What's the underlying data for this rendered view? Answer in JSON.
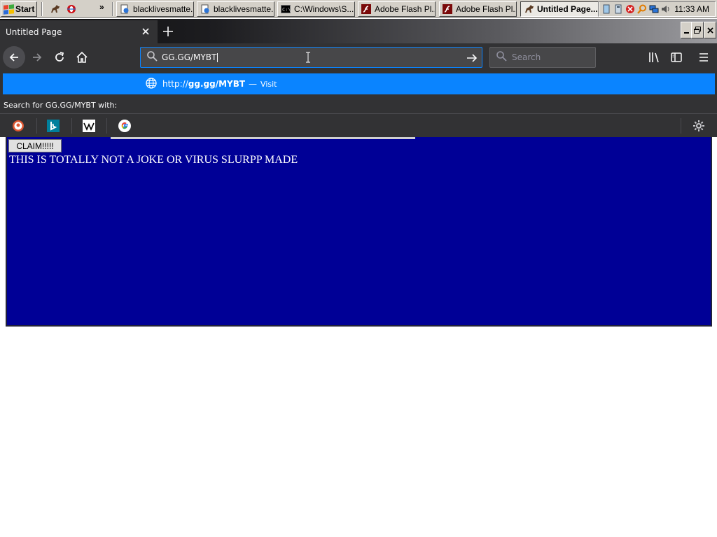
{
  "taskbar": {
    "start_label": "Start",
    "tasks": [
      {
        "label": "blacklivesmatte...",
        "icon": "ie-page-icon"
      },
      {
        "label": "blacklivesmatte...",
        "icon": "ie-page-icon"
      },
      {
        "label": "C:\\Windows\\S...",
        "icon": "cmd-icon"
      },
      {
        "label": "Adobe Flash Pl...",
        "icon": "flash-icon"
      },
      {
        "label": "Adobe Flash Pl...",
        "icon": "flash-icon"
      },
      {
        "label": "Untitled Page...",
        "icon": "firefox-icon"
      }
    ],
    "quicklaunch_more": "»",
    "clock": "11:33 AM"
  },
  "browser": {
    "tab_title": "Untitled Page",
    "urlbar_value": "GG.GG/MYBT",
    "search_placeholder": "Search"
  },
  "suggestion": {
    "prefix": "http://",
    "host": "gg.gg/MYBT",
    "dash": "—",
    "action": "Visit",
    "search_with": "Search for GG.GG/MYBT with:"
  },
  "page": {
    "button_label": "CLAIM!!!!!",
    "message": "THIS IS TOTALLY NOT A JOKE OR VIRUS SLURPP MADE"
  },
  "colors": {
    "accent": "#0a84ff",
    "page_bg": "#000096",
    "toolbar": "#323234"
  }
}
